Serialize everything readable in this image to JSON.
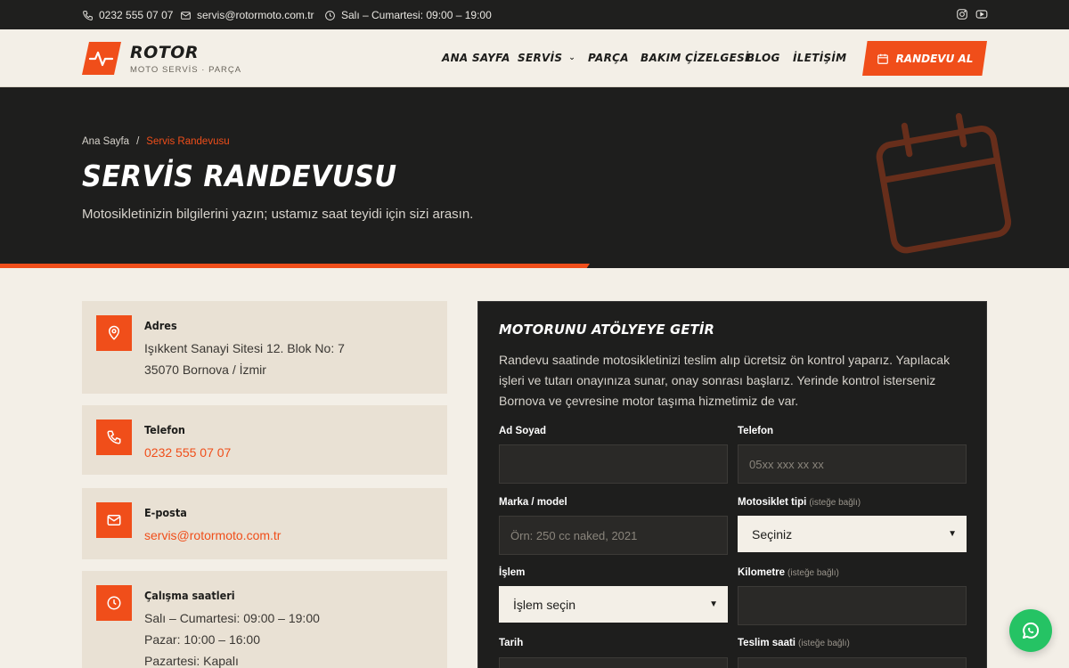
{
  "topbar": {
    "phone": "0232 555 07 07",
    "email": "servis@rotormoto.com.tr",
    "hours": "Salı – Cumartesi: 09:00 – 19:00"
  },
  "brand": {
    "name": "ROTOR",
    "tagline": "MOTO SERVİS · PARÇA",
    "accent": "#f04e1a",
    "dark": "#1e1e1d",
    "cream": "#f3efe7"
  },
  "nav": {
    "items": [
      "ANA SAYFA",
      "SERVİS",
      "PARÇA",
      "BAKIM ÇİZELGESİ",
      "BLOG",
      "İLETİŞİM"
    ],
    "cta": "RANDEVU AL"
  },
  "hero": {
    "breadcrumb_home": "Ana Sayfa",
    "breadcrumb_sep": "/",
    "breadcrumb_current": "Servis Randevusu",
    "title": "SERVİS RANDEVUSU",
    "subtitle": "Motosikletinizin bilgilerini yazın; ustamız saat teyidi için sizi arasın."
  },
  "contact": {
    "address": {
      "title": "Adres",
      "line1": "Işıkkent Sanayi Sitesi 12. Blok No: 7",
      "line2": "35070 Bornova / İzmir",
      "icon": "map-pin-icon"
    },
    "phone": {
      "title": "Telefon",
      "value": "0232 555 07 07",
      "icon": "phone-icon"
    },
    "email": {
      "title": "E-posta",
      "value": "servis@rotormoto.com.tr",
      "icon": "mail-icon"
    },
    "hours": {
      "title": "Çalışma saatleri",
      "line1": "Salı – Cumartesi: 09:00 – 19:00",
      "line2": "Pazar: 10:00 – 16:00",
      "line3": "Pazartesi: Kapalı",
      "icon": "clock-icon"
    }
  },
  "form": {
    "title": "MOTORUNU ATÖLYEYE GETİR",
    "intro": "Randevu saatinde motosikletinizi teslim alıp ücretsiz ön kontrol yaparız. Yapılacak işleri ve tutarı onayınıza sunar, onay sonrası başlarız. Yerinde kontrol isterseniz Bornova ve çevresine motor taşıma hizmetimiz de var.",
    "optional_tag": "(isteğe bağlı)",
    "fields": {
      "name_label": "Ad Soyad",
      "name_value": "",
      "phone_label": "Telefon",
      "phone_placeholder": "05xx xxx xx xx",
      "model_label": "Marka / model",
      "model_placeholder": "Örn: 250 cc naked, 2021",
      "type_label": "Motosiklet tipi",
      "type_value": "Seçiniz",
      "service_label": "İşlem",
      "service_value": "İşlem seçin",
      "km_label": "Kilometre",
      "km_value": "",
      "date_label": "Tarih",
      "time_label": "Teslim saati"
    }
  }
}
